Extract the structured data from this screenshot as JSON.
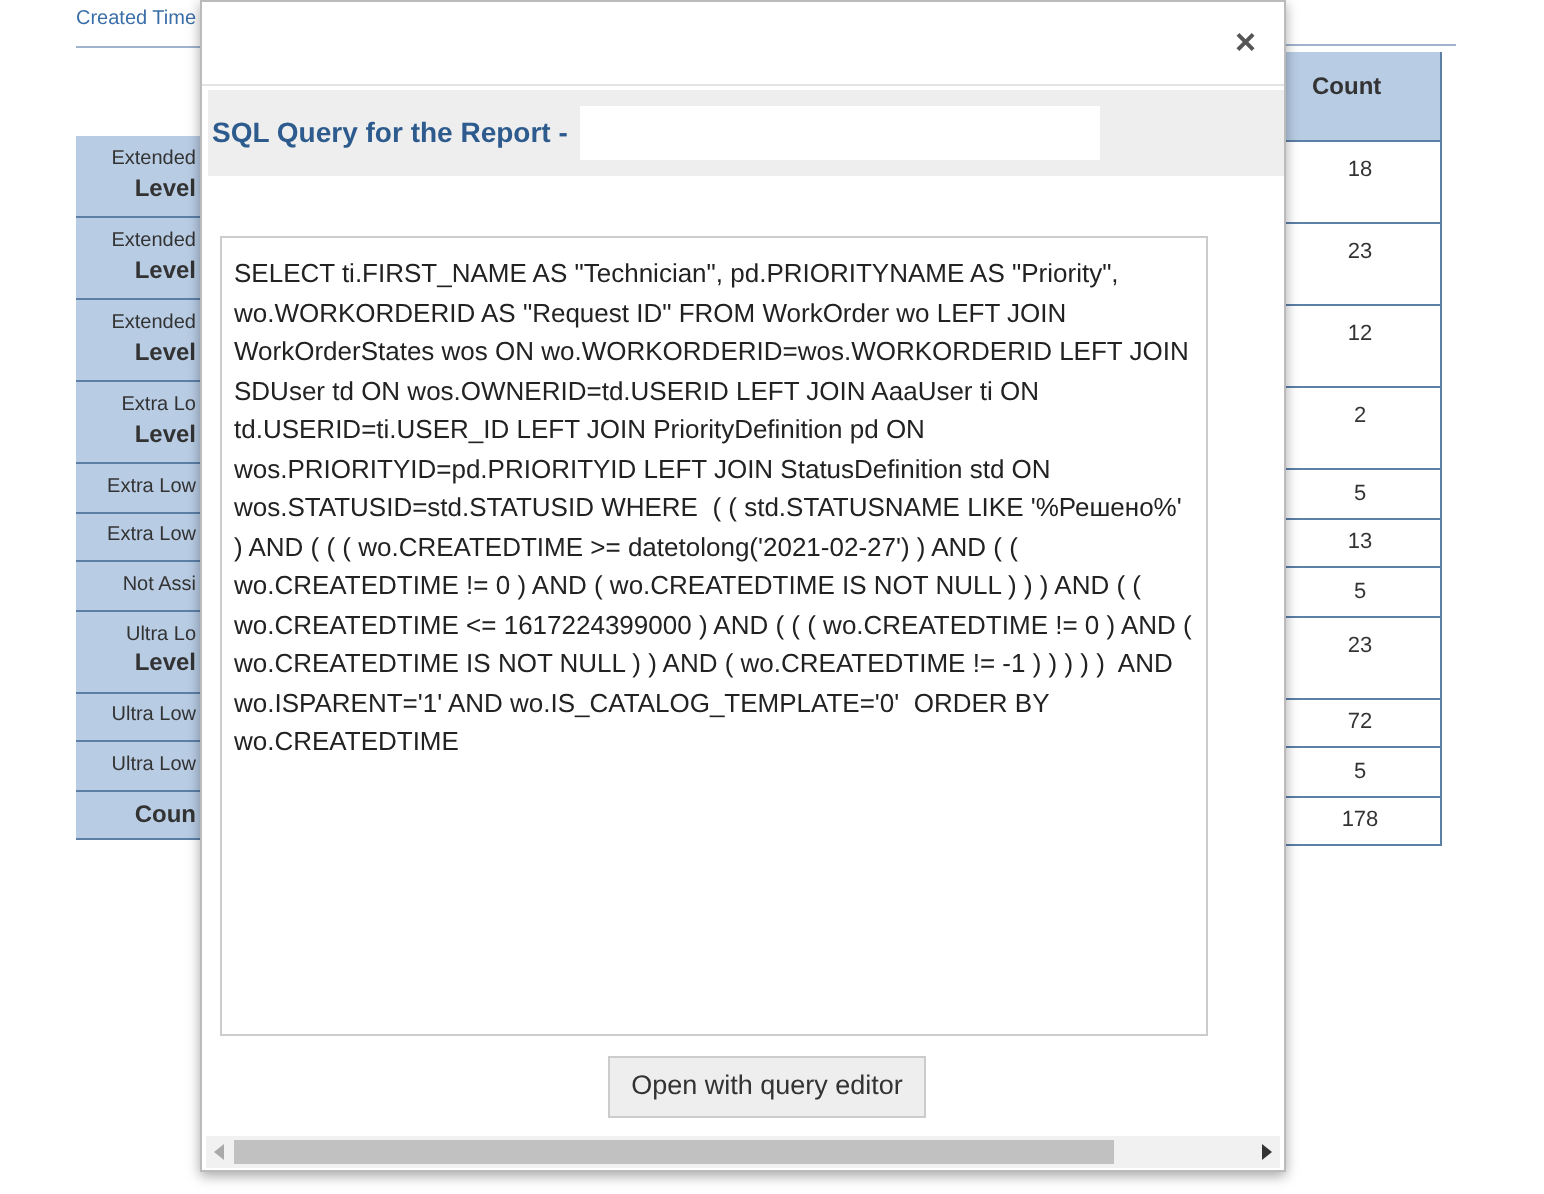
{
  "background_report": {
    "filter_label": "Created Time",
    "rows": [
      {
        "label": [
          "Extended",
          "Level"
        ],
        "count": "18",
        "kind": "tall"
      },
      {
        "label": [
          "Extended",
          "Level"
        ],
        "count": "23",
        "kind": "tall"
      },
      {
        "label": [
          "Extended",
          "Level"
        ],
        "count": "12",
        "kind": "tall"
      },
      {
        "label": [
          "Extra Lo",
          "Level"
        ],
        "count": "2",
        "kind": "tall"
      },
      {
        "label": [
          "Extra Low"
        ],
        "count": "5",
        "kind": "short"
      },
      {
        "label": [
          "Extra Low"
        ],
        "count": "13",
        "kind": "short"
      },
      {
        "label": [
          "Not Assi"
        ],
        "count": "5",
        "kind": "short"
      },
      {
        "label": [
          "Ultra Lo",
          "Level"
        ],
        "count": "23",
        "kind": "tall"
      },
      {
        "label": [
          "Ultra Low"
        ],
        "count": "72",
        "kind": "short"
      },
      {
        "label": [
          "Ultra Low"
        ],
        "count": "5",
        "kind": "short"
      },
      {
        "label": [
          "Coun"
        ],
        "count": "178",
        "kind": "total"
      }
    ],
    "count_header": "Count"
  },
  "dialog": {
    "close": "×",
    "title": "SQL Query for the Report -",
    "query": "SELECT ti.FIRST_NAME AS \"Technician\", pd.PRIORITYNAME AS \"Priority\", wo.WORKORDERID AS \"Request ID\" FROM WorkOrder wo LEFT JOIN WorkOrderStates wos ON wo.WORKORDERID=wos.WORKORDERID LEFT JOIN SDUser td ON wos.OWNERID=td.USERID LEFT JOIN AaaUser ti ON td.USERID=ti.USER_ID LEFT JOIN PriorityDefinition pd ON wos.PRIORITYID=pd.PRIORITYID LEFT JOIN StatusDefinition std ON wos.STATUSID=std.STATUSID WHERE  ( ( std.STATUSNAME LIKE '%Решено%' ) AND ( ( ( wo.CREATEDTIME >= datetolong('2021-02-27') ) AND ( ( wo.CREATEDTIME != 0 ) AND ( wo.CREATEDTIME IS NOT NULL ) ) ) AND ( ( wo.CREATEDTIME <= 1617224399000 ) AND ( ( ( wo.CREATEDTIME != 0 ) AND ( wo.CREATEDTIME IS NOT NULL ) ) AND ( wo.CREATEDTIME != -1 ) ) ) ) )  AND wo.ISPARENT='1' AND wo.IS_CATALOG_TEMPLATE='0'  ORDER BY wo.CREATEDTIME",
    "button": "Open with query editor"
  }
}
